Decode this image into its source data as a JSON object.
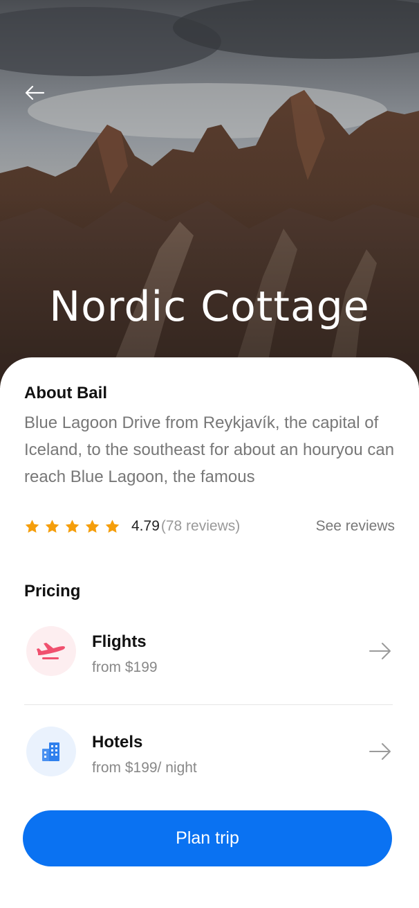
{
  "hero": {
    "title": "Nordic Cottage",
    "back_icon": "arrow-left-icon"
  },
  "about": {
    "heading": "About Bail",
    "text": "Blue Lagoon Drive from Reykjavík, the capital of Iceland, to the southeast for about an houryou can reach Blue Lagoon, the famous"
  },
  "rating": {
    "stars": 5,
    "score": "4.79",
    "reviews": "(78 reviews)",
    "see_reviews": "See reviews",
    "star_color": "#f59e0b"
  },
  "pricing": {
    "heading": "Pricing",
    "items": [
      {
        "title": "Flights",
        "subtitle": "from $199",
        "icon": "airplane-icon",
        "icon_color": "#f0506e",
        "icon_bg": "#fdeef0"
      },
      {
        "title": "Hotels",
        "subtitle": "from $199/ night",
        "icon": "hotel-building-icon",
        "icon_color": "#2f80ed",
        "icon_bg": "#eaf2fd"
      }
    ]
  },
  "cta": {
    "label": "Plan trip",
    "color": "#0a72f2"
  }
}
